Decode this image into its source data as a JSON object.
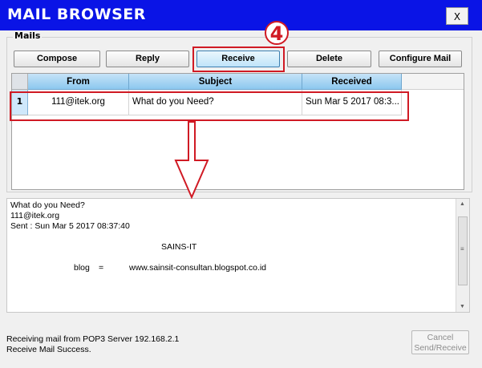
{
  "window": {
    "title": "MAIL BROWSER",
    "close_label": "X"
  },
  "mails_group": {
    "label": "Mails"
  },
  "toolbar": {
    "compose": "Compose",
    "reply": "Reply",
    "receive": "Receive",
    "delete": "Delete",
    "configure": "Configure Mail"
  },
  "table": {
    "columns": [
      "From",
      "Subject",
      "Received"
    ],
    "rows": [
      {
        "num": "1",
        "from": "111@itek.org",
        "subject": "What do you Need?",
        "received": "Sun Mar 5 2017 08:3..."
      }
    ]
  },
  "preview": {
    "subject": "What do you Need?",
    "from": "111@itek.org",
    "sent": "Sent : Sun Mar 5 2017 08:37:40",
    "company": "SAINS-IT",
    "blog_label": "blog",
    "blog_eq": "=",
    "blog_url": "www.sainsit-consultan.blogspot.co.id"
  },
  "status": {
    "line1": "Receiving mail from POP3 Server 192.168.2.1",
    "line2": "Receive Mail Success."
  },
  "cancel_button": {
    "line1": "Cancel",
    "line2": "Send/Receive"
  },
  "annotation": {
    "step_number": "4",
    "color": "#d01a24"
  }
}
